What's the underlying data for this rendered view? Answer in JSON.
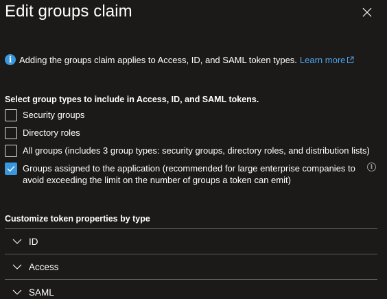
{
  "panel": {
    "title": "Edit groups claim"
  },
  "info": {
    "text": "Adding the groups claim applies to Access, ID, and SAML token types.",
    "link_label": "Learn more"
  },
  "group_types": {
    "heading": "Select group types to include in Access, ID, and SAML tokens.",
    "options": [
      {
        "label": "Security groups",
        "checked": false
      },
      {
        "label": "Directory roles",
        "checked": false
      },
      {
        "label": "All groups (includes 3 group types: security groups, directory roles, and distribution lists)",
        "checked": false
      },
      {
        "label": "Groups assigned to the application (recommended for large enterprise companies to avoid exceeding the limit on the number of groups a token can emit)",
        "checked": true
      }
    ]
  },
  "token_props": {
    "heading": "Customize token properties by type",
    "sections": [
      {
        "label": "ID"
      },
      {
        "label": "Access"
      },
      {
        "label": "SAML"
      }
    ]
  },
  "colors": {
    "background": "#1b1a19",
    "accent": "#3a96dd",
    "link": "#4fa3ea",
    "divider": "#605e5c"
  }
}
